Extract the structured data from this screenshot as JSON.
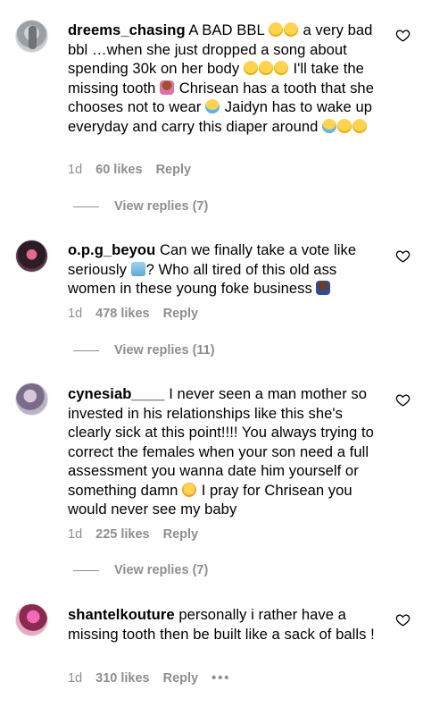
{
  "comments": [
    {
      "username": "dreems_chasing",
      "segments": [
        "A BAD BBL ",
        " a very bad bbl …when she just dropped a song about spending 30k on her body ",
        " I'll take the missing tooth ",
        " Chrisean has a tooth that she chooses not to wear ",
        " Jaidyn has to wake up everyday and carry this diaper around "
      ],
      "time": "1d",
      "likes": "60 likes",
      "reply_label": "Reply",
      "view_replies": "View replies (7)"
    },
    {
      "username": "o.p.g_beyou",
      "segments": [
        "Can we finally take a vote like seriously ",
        "? Who all tired of this old ass women in these young foke business "
      ],
      "time": "1d",
      "likes": "478 likes",
      "reply_label": "Reply",
      "view_replies": "View replies (11)"
    },
    {
      "username": "cynesiab____",
      "segments": [
        "I never seen a man mother so invested in his relationships like this she's clearly sick at this point!!!! You always trying to correct the females when your son need a full assessment you wanna date him yourself or something damn ",
        " I pray for Chrisean you would never see my baby"
      ],
      "time": "1d",
      "likes": "225 likes",
      "reply_label": "Reply",
      "view_replies": "View replies (7)"
    },
    {
      "username": "shantelkouture",
      "segments": [
        "personally i rather have a missing tooth then be built like a sack of balls !"
      ],
      "time": "1d",
      "likes": "310 likes",
      "reply_label": "Reply",
      "more_label": "•••"
    }
  ],
  "icons": {
    "like": "heart-outline-icon",
    "emoji_laugh": "face-with-tears-of-joy",
    "emoji_cry": "loudly-crying-face",
    "emoji_facepalm": "woman-facepalming",
    "emoji_ballot": "ballot-box",
    "emoji_raise_hand": "man-raising-hand",
    "emoji_dizzy": "face-with-spiral-eyes"
  },
  "colors": {
    "text": "#000000",
    "muted": "#8e8e8e",
    "background": "#ffffff"
  }
}
